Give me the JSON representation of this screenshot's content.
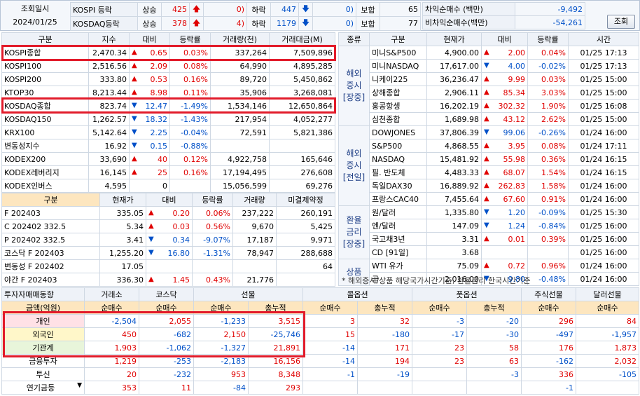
{
  "top": {
    "lookup_label": "조회일시",
    "date": "2024/01/25",
    "rows": [
      {
        "market": "KOSPI 등락",
        "up_label": "상승",
        "up": "425",
        "limit_up": "0",
        "down_label": "하락",
        "down": "447",
        "limit_down": "0",
        "flat_label": "보합",
        "flat": "65"
      },
      {
        "market": "KOSDAQ등락",
        "up_label": "상승",
        "up": "378",
        "limit_up": "4",
        "down_label": "하락",
        "down": "1179",
        "limit_down": "0",
        "flat_label": "보합",
        "flat": "77"
      }
    ],
    "arb": [
      {
        "label": "차익순매수 (백만)",
        "value": "-9,492"
      },
      {
        "label": "비차익순매수(백만)",
        "value": "-54,261"
      }
    ],
    "search_button": "조회"
  },
  "index_table": {
    "headers": [
      "구분",
      "지수",
      "대비",
      "등락률",
      "거래량(천)",
      "거래대금(M)"
    ],
    "rows": [
      {
        "name": "KOSPI종합",
        "value": "2,470.34",
        "dir": "up",
        "chg": "0.65",
        "pct": "0.03%",
        "vol": "337,264",
        "amt": "7,509,896"
      },
      {
        "name": "KOSPI100",
        "value": "2,516.56",
        "dir": "up",
        "chg": "2.09",
        "pct": "0.08%",
        "vol": "64,990",
        "amt": "4,895,285"
      },
      {
        "name": "KOSPI200",
        "value": "333.80",
        "dir": "up",
        "chg": "0.53",
        "pct": "0.16%",
        "vol": "89,720",
        "amt": "5,450,862"
      },
      {
        "name": "KTOP30",
        "value": "8,213.44",
        "dir": "up",
        "chg": "8.98",
        "pct": "0.11%",
        "vol": "35,906",
        "amt": "3,268,081"
      },
      {
        "name": "KOSDAQ종합",
        "value": "823.74",
        "dir": "dn",
        "chg": "12.47",
        "pct": "-1.49%",
        "vol": "1,534,146",
        "amt": "12,650,864"
      },
      {
        "name": "KOSDAQ150",
        "value": "1,262.57",
        "dir": "dn",
        "chg": "18.32",
        "pct": "-1.43%",
        "vol": "217,954",
        "amt": "4,052,277"
      },
      {
        "name": "KRX100",
        "value": "5,142.64",
        "dir": "dn",
        "chg": "2.25",
        "pct": "-0.04%",
        "vol": "72,591",
        "amt": "5,821,386"
      },
      {
        "name": "변동성지수",
        "value": "16.92",
        "dir": "dn",
        "chg": "0.15",
        "pct": "-0.88%",
        "vol": "",
        "amt": ""
      },
      {
        "name": "KODEX200",
        "value": "33,690",
        "dir": "up",
        "chg": "40",
        "pct": "0.12%",
        "vol": "4,922,758",
        "amt": "165,646"
      },
      {
        "name": "KODEX레버리지",
        "value": "16,145",
        "dir": "up",
        "chg": "25",
        "pct": "0.16%",
        "vol": "17,194,495",
        "amt": "276,608"
      },
      {
        "name": "KODEX인버스",
        "value": "4,595",
        "dir": "none",
        "chg": "0",
        "pct": "",
        "vol": "15,056,599",
        "amt": "69,276"
      }
    ]
  },
  "futures_table": {
    "headers": [
      "구분",
      "현재가",
      "대비",
      "등락률",
      "거래량",
      "미결제약정"
    ],
    "rows": [
      {
        "name": "F 202403",
        "value": "335.05",
        "dir": "up",
        "chg": "0.20",
        "pct": "0.06%",
        "vol": "237,222",
        "oi": "260,191"
      },
      {
        "name": "C 202402 332.5",
        "value": "5.34",
        "dir": "up",
        "chg": "0.03",
        "pct": "0.56%",
        "vol": "9,670",
        "oi": "5,425"
      },
      {
        "name": "P 202402 332.5",
        "value": "3.41",
        "dir": "dn",
        "chg": "0.34",
        "pct": "-9.07%",
        "vol": "17,187",
        "oi": "9,971"
      },
      {
        "name": "코스닥 F 202403",
        "value": "1,255.20",
        "dir": "dn",
        "chg": "16.80",
        "pct": "-1.31%",
        "vol": "78,947",
        "oi": "288,688"
      },
      {
        "name": "변동성 F 202402",
        "value": "17.05",
        "dir": "none",
        "chg": "",
        "pct": "",
        "vol": "",
        "oi": "64"
      },
      {
        "name": "야간 F 202403",
        "value": "336.30",
        "dir": "up",
        "chg": "1.45",
        "pct": "0.43%",
        "vol": "21,776",
        "oi": ""
      }
    ]
  },
  "overseas_table": {
    "headers": [
      "종류",
      "구분",
      "현재가",
      "대비",
      "등락률",
      "시간"
    ],
    "groups": [
      {
        "label_lines": [
          "해외",
          "증시",
          "[장중]"
        ],
        "rows": [
          {
            "name": "미니S&P500",
            "value": "4,900.00",
            "dir": "up",
            "chg": "2.00",
            "pct": "0.04%",
            "time": "01/25 17:13"
          },
          {
            "name": "미니NASDAQ",
            "value": "17,617.00",
            "dir": "dn",
            "chg": "4.00",
            "pct": "-0.02%",
            "time": "01/25 17:13"
          },
          {
            "name": "니케이225",
            "value": "36,236.47",
            "dir": "up",
            "chg": "9.99",
            "pct": "0.03%",
            "time": "01/25 15:00"
          },
          {
            "name": "상해종합",
            "value": "2,906.11",
            "dir": "up",
            "chg": "85.34",
            "pct": "3.03%",
            "time": "01/25 15:00"
          },
          {
            "name": "홍콩항셍",
            "value": "16,202.19",
            "dir": "up",
            "chg": "302.32",
            "pct": "1.90%",
            "time": "01/25 16:08"
          },
          {
            "name": "심천종합",
            "value": "1,689.98",
            "dir": "up",
            "chg": "43.12",
            "pct": "2.62%",
            "time": "01/25 15:00"
          }
        ]
      },
      {
        "label_lines": [
          "해외",
          "증시",
          "[전일]"
        ],
        "rows": [
          {
            "name": "DOWJONES",
            "value": "37,806.39",
            "dir": "dn",
            "chg": "99.06",
            "pct": "-0.26%",
            "time": "01/24 16:00"
          },
          {
            "name": "S&P500",
            "value": "4,868.55",
            "dir": "up",
            "chg": "3.95",
            "pct": "0.08%",
            "time": "01/24 17:11"
          },
          {
            "name": "NASDAQ",
            "value": "15,481.92",
            "dir": "up",
            "chg": "55.98",
            "pct": "0.36%",
            "time": "01/24 16:15"
          },
          {
            "name": "필. 반도체",
            "value": "4,483.33",
            "dir": "up",
            "chg": "68.07",
            "pct": "1.54%",
            "time": "01/24 16:15"
          },
          {
            "name": "독일DAX30",
            "value": "16,889.92",
            "dir": "up",
            "chg": "262.83",
            "pct": "1.58%",
            "time": "01/24 16:00"
          },
          {
            "name": "프랑스CAC40",
            "value": "7,455.64",
            "dir": "up",
            "chg": "67.60",
            "pct": "0.91%",
            "time": "01/24 16:00"
          }
        ]
      },
      {
        "label_lines": [
          "환율",
          "금리",
          "[장중]"
        ],
        "rows": [
          {
            "name": "원/달러",
            "value": "1,335.80",
            "dir": "dn",
            "chg": "1.20",
            "pct": "-0.09%",
            "time": "01/25 15:30"
          },
          {
            "name": "엔/달러",
            "value": "147.09",
            "dir": "dn",
            "chg": "1.24",
            "pct": "-0.84%",
            "time": "01/25 16:00"
          },
          {
            "name": "국고채3년",
            "value": "3.31",
            "dir": "up",
            "chg": "0.01",
            "pct": "0.39%",
            "time": "01/25 16:00"
          },
          {
            "name": "CD [91일]",
            "value": "3.68",
            "dir": "none",
            "chg": "",
            "pct": "",
            "time": "01/25 16:00"
          }
        ]
      },
      {
        "label_lines": [
          "상품"
        ],
        "rows": [
          {
            "name": "WTI 유가",
            "value": "75.09",
            "dir": "up",
            "chg": "0.72",
            "pct": "0.96%",
            "time": "01/24 16:00"
          },
          {
            "name": "금",
            "value": "2,016.00",
            "dir": "dn",
            "chg": "9.80",
            "pct": "-0.48%",
            "time": "01/24 16:00"
          }
        ]
      }
    ],
    "footnote": "* 해외증시/상품 해당국가시간기준, 환율금리 한국시간기준"
  },
  "investor_table": {
    "title": "투자자매매동향",
    "unit_label": "금액(억원)",
    "groups": [
      "거래소",
      "코스닥",
      "선물",
      "콜옵션",
      "풋옵션",
      "주식선물",
      "달러선물"
    ],
    "subheaders": [
      "순매수",
      "순매수",
      "순매수",
      "총누적",
      "순매수",
      "총누적",
      "순매수",
      "총누적",
      "순매수",
      "순매수"
    ],
    "rows": [
      {
        "name": "개인",
        "vals": [
          "-2,504",
          "2,055",
          "-1,233",
          "3,515",
          "3",
          "32",
          "-3",
          "-20",
          "296",
          "84"
        ]
      },
      {
        "name": "외국인",
        "vals": [
          "450",
          "-682",
          "2,150",
          "-25,746",
          "15",
          "-180",
          "-17",
          "-30",
          "-497",
          "-1,957"
        ]
      },
      {
        "name": "기관계",
        "vals": [
          "1,903",
          "-1,062",
          "-1,327",
          "21,891",
          "-14",
          "171",
          "23",
          "58",
          "176",
          "1,873"
        ]
      },
      {
        "name": "금융투자",
        "vals": [
          "1,219",
          "-253",
          "-2,183",
          "16,156",
          "-14",
          "194",
          "23",
          "63",
          "-162",
          "2,032"
        ]
      },
      {
        "name": "투신",
        "vals": [
          "20",
          "-232",
          "953",
          "8,348",
          "-1",
          "-19",
          "",
          "-3",
          "336",
          "-105"
        ]
      },
      {
        "name": "연기금등",
        "vals": [
          "353",
          "11",
          "-84",
          "293",
          "",
          "",
          "",
          "",
          "-1",
          ""
        ]
      }
    ]
  }
}
